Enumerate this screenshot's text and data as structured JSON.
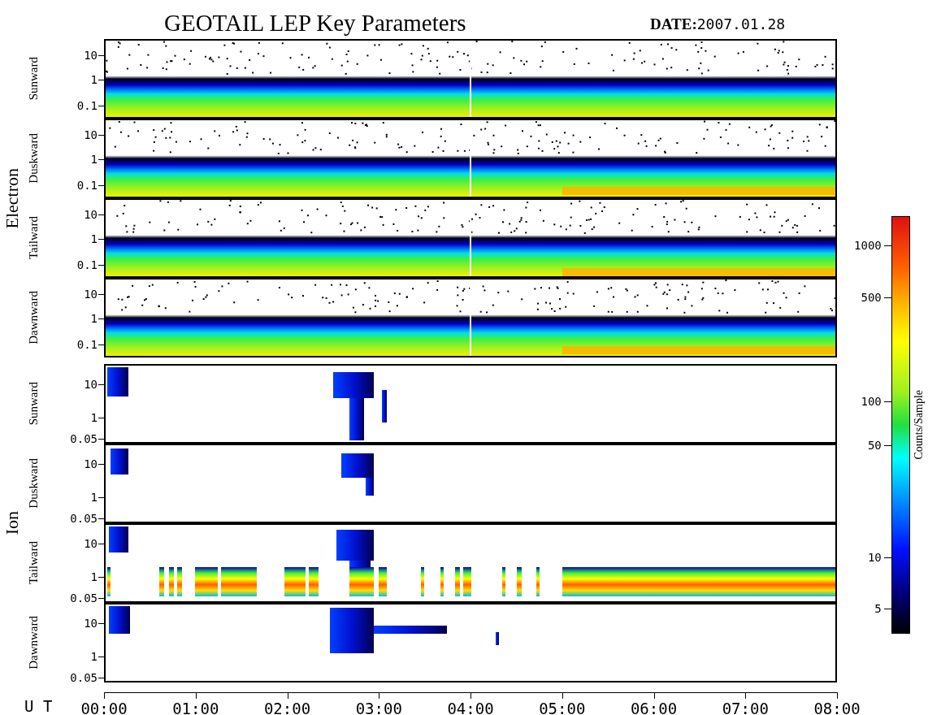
{
  "title": "GEOTAIL LEP Key Parameters",
  "date_label": "DATE:",
  "date": "2007.01.28",
  "groups": [
    {
      "name": "Electron",
      "panels": [
        {
          "label": "Sunward",
          "kind": "electron",
          "yticks": [
            "10",
            "1",
            "0.1"
          ]
        },
        {
          "label": "Duskward",
          "kind": "electron",
          "yticks": [
            "10",
            "1",
            "0.1"
          ]
        },
        {
          "label": "Tailward",
          "kind": "electron",
          "yticks": [
            "10",
            "1",
            "0.1"
          ]
        },
        {
          "label": "Dawnward",
          "kind": "electron",
          "yticks": [
            "10",
            "1",
            "0.1"
          ]
        }
      ]
    },
    {
      "name": "Ion",
      "panels": [
        {
          "label": "Sunward",
          "kind": "ion",
          "yticks": [
            "10",
            "1",
            "0.05"
          ]
        },
        {
          "label": "Duskward",
          "kind": "ion",
          "yticks": [
            "10",
            "1",
            "0.05"
          ]
        },
        {
          "label": "Tailward",
          "kind": "ion-band",
          "yticks": [
            "10",
            "1",
            "0.05"
          ]
        },
        {
          "label": "Dawnward",
          "kind": "ion",
          "yticks": [
            "10",
            "1",
            "0.05"
          ]
        }
      ]
    }
  ],
  "x_axis": {
    "label": "U T",
    "ticks": [
      "00:00",
      "01:00",
      "02:00",
      "03:00",
      "04:00",
      "05:00",
      "06:00",
      "07:00",
      "08:00"
    ]
  },
  "colorbar": {
    "title": "Counts/Sample",
    "ticks": [
      "1000",
      "500",
      "100",
      "50",
      "10",
      "5"
    ]
  }
}
